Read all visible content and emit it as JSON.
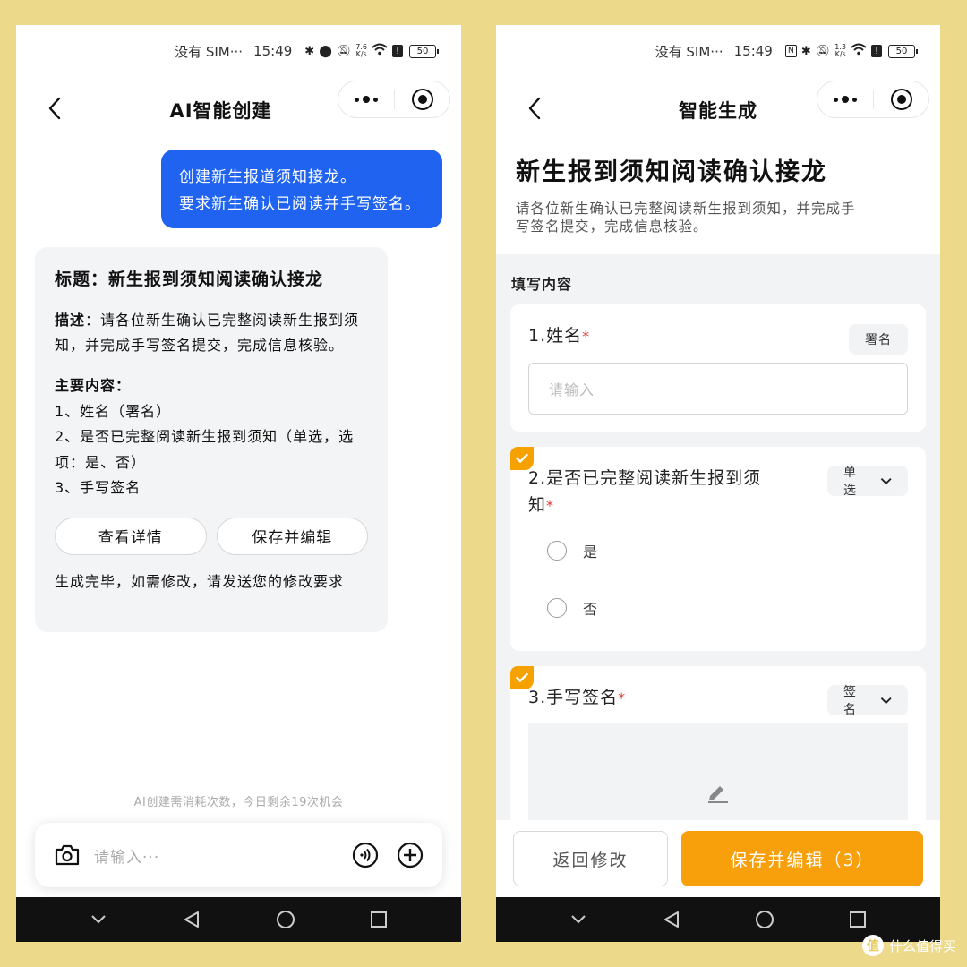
{
  "status_left": {
    "carrier": "没有 SIM···",
    "time": "15:49",
    "speed_value": "7.6",
    "speed_unit": "K/s",
    "battery": "50"
  },
  "status_right": {
    "carrier": "没有 SIM···",
    "time": "15:49",
    "speed_value": "1.3",
    "speed_unit": "K/s",
    "battery": "50"
  },
  "chat": {
    "nav_title": "AI智能创建",
    "user_message_line1": "创建新生报道须知接龙。",
    "user_message_line2": "要求新生确认已阅读并手写签名。",
    "ai_title": "标题：新生报到须知阅读确认接龙",
    "ai_desc_label": "描述",
    "ai_desc_text": "：请各位新生确认已完整阅读新生报到须知，并完成手写签名提交，完成信息核验。",
    "ai_main_label": "主要内容：",
    "ai_main_items": [
      "1、姓名（署名）",
      "2、是否已完整阅读新生报到须知（单选，选项：是、否）",
      "3、手写签名"
    ],
    "btn_details": "查看详情",
    "btn_save_edit": "保存并编辑",
    "ai_footer": "生成完毕，如需修改，请发送您的修改要求",
    "quota_notice": "AI创建需消耗次数，今日剩余19次机会",
    "input_placeholder": "请输入···"
  },
  "form": {
    "nav_title": "智能生成",
    "title": "新生报到须知阅读确认接龙",
    "desc_line1": "请各位新生确认已完整阅读新生报到须知，并完成手",
    "desc_line2": "写签名提交，完成信息核验。",
    "section_label": "填写内容",
    "q1": {
      "title": "1.姓名",
      "required": "*",
      "tag": "署名",
      "placeholder": "请输入"
    },
    "q2": {
      "title_line1": "2.是否已完整阅读新生报到须",
      "title_line2": "知",
      "required": "*",
      "tag": "单选",
      "options": [
        "是",
        "否"
      ]
    },
    "q3": {
      "title": "3.手写签名",
      "required": "*",
      "tag": "签名"
    },
    "btn_back_edit": "返回修改",
    "btn_save_edit": "保存并编辑（3）"
  },
  "watermark": {
    "logo": "值",
    "text": "什么值得买"
  },
  "colors": {
    "background": "#EDD98A",
    "primary_blue": "#1F63F0",
    "accent_orange": "#F8A00C",
    "required_red": "#E53935"
  }
}
